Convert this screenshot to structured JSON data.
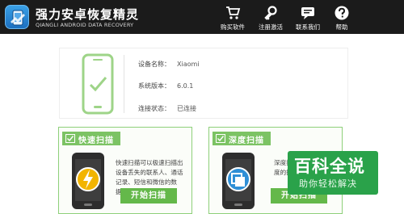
{
  "app": {
    "title": "强力安卓恢复精灵",
    "subtitle": "QIANGLI ANDROID DATA RECOVERY"
  },
  "nav": [
    {
      "label": "购买软件",
      "icon": "cart-icon"
    },
    {
      "label": "注册激活",
      "icon": "key-icon"
    },
    {
      "label": "联系我们",
      "icon": "chat-icon"
    },
    {
      "label": "帮助",
      "icon": "help-icon"
    }
  ],
  "device": {
    "name_label": "设备名称：",
    "name_value": "Xiaomi",
    "version_label": "系统版本：",
    "version_value": "6.0.1",
    "status_label": "连接状态：",
    "status_value": "已连接"
  },
  "quick_scan": {
    "title": "快速扫描",
    "desc": "快速扫描可以极速扫描出设备丢失的联系人、通话记录、短信和微信的数据。",
    "button": "开始扫描"
  },
  "deep_scan": {
    "title": "深度扫描",
    "desc": "深度扫描度的找回",
    "button": "开始扫描"
  },
  "watermark": {
    "main": "百科全说",
    "sub": "助你轻松解决"
  },
  "colors": {
    "titlebar": "#1b1b1b",
    "accent_green": "#7cc364",
    "button_green": "#64b84a",
    "watermark_green": "#2aa24a"
  }
}
